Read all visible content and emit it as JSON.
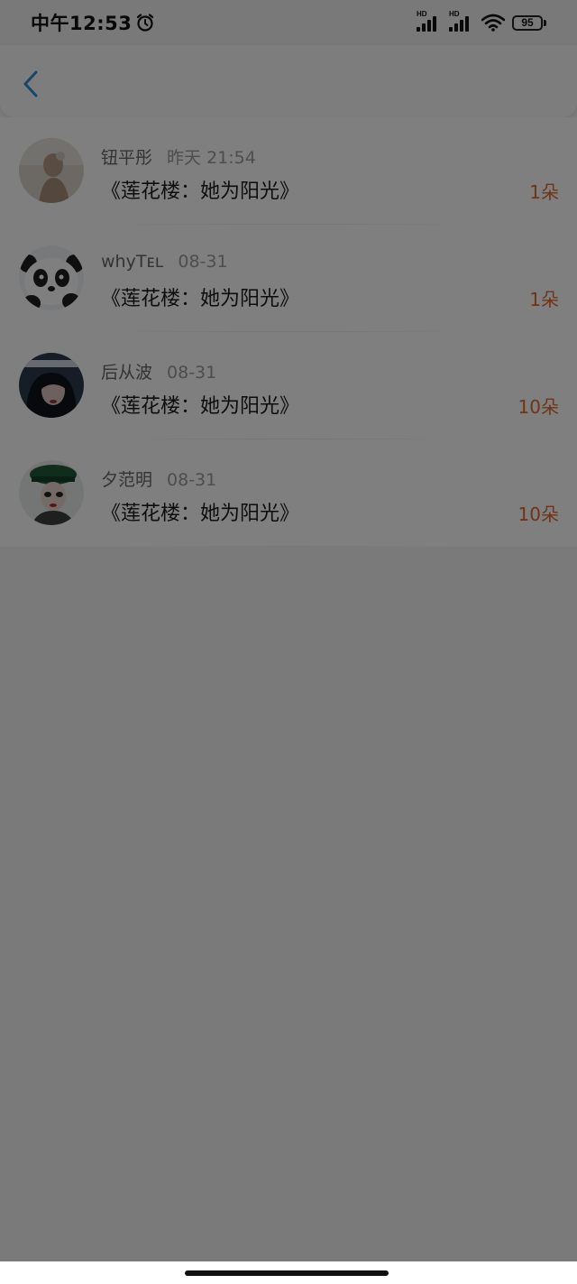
{
  "status_bar": {
    "time": "中午12:53",
    "network_badge_1": "HD",
    "network_badge_2": "HD",
    "battery_level": "95"
  },
  "header": {
    "back_icon": "chevron-left-icon"
  },
  "list": {
    "items": [
      {
        "name": "钮平彤",
        "time": "昨天 21:54",
        "title": "《莲花楼：她为阳光》",
        "count": "1朵",
        "avatar": "avatar-photo-1"
      },
      {
        "name": "whyTᴇʟ",
        "time": "08-31",
        "title": "《莲花楼：她为阳光》",
        "count": "1朵",
        "avatar": "avatar-panda"
      },
      {
        "name": "后从波",
        "time": "08-31",
        "title": "《莲花楼：她为阳光》",
        "count": "10朵",
        "avatar": "avatar-photo-3"
      },
      {
        "name": "夕范明",
        "time": "08-31",
        "title": "《莲花楼：她为阳光》",
        "count": "10朵",
        "avatar": "avatar-photo-4"
      }
    ]
  },
  "colors": {
    "accent_blue": "#2a8fd8",
    "count_orange": "#e0662c",
    "overlay": "rgba(0,0,0,0.5)"
  }
}
